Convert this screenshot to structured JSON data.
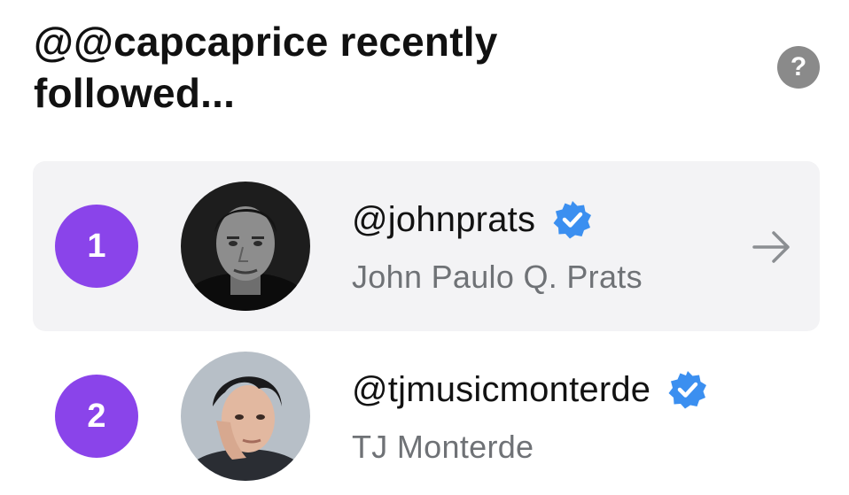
{
  "header": {
    "title": "@@capcaprice recently followed...",
    "help_icon": "question-mark-icon",
    "help_symbol": "?"
  },
  "accounts": [
    {
      "rank": "1",
      "handle": "@johnprats",
      "name": "John Paulo Q. Prats",
      "verified": true,
      "highlighted": true,
      "action_icon": "arrow-right-icon"
    },
    {
      "rank": "2",
      "handle": "@tjmusicmonterde",
      "name": "TJ Monterde",
      "verified": true,
      "highlighted": false
    }
  ],
  "colors": {
    "rank_badge": "#8a44ea",
    "verified_badge": "#3b8ff0",
    "highlight_background": "#f3f3f5",
    "secondary_text": "#6f7276",
    "help_icon": "#8a8a8a"
  }
}
